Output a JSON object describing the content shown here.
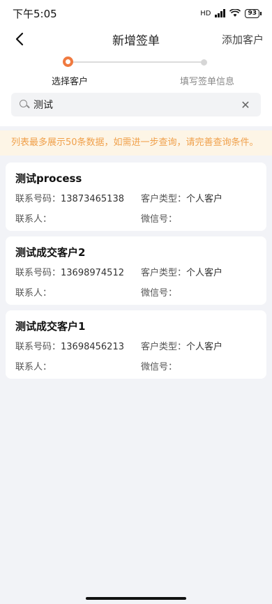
{
  "status": {
    "time": "下午5:05",
    "battery": "93",
    "network": "HD"
  },
  "nav": {
    "title": "新增签单",
    "action": "添加客户"
  },
  "steps": [
    {
      "label": "选择客户"
    },
    {
      "label": "填写签单信息"
    }
  ],
  "search": {
    "value": "测试"
  },
  "notice": "列表最多展示50条数据，如需进一步查询，请完善查询条件。",
  "labels": {
    "phone": "联系号码：",
    "type": "客户类型：",
    "contact": "联系人：",
    "wechat": "微信号："
  },
  "customers": [
    {
      "name": "测试process",
      "phone": "13873465138",
      "type": "个人客户",
      "contact": "",
      "wechat": ""
    },
    {
      "name": "测试成交客户2",
      "phone": "13698974512",
      "type": "个人客户",
      "contact": "",
      "wechat": ""
    },
    {
      "name": "测试成交客户1",
      "phone": "13698456213",
      "type": "个人客户",
      "contact": "",
      "wechat": ""
    }
  ],
  "colors": {
    "accent": "#f07a40",
    "notice_text": "#f0a04b",
    "notice_bg": "#fdf5e6"
  }
}
